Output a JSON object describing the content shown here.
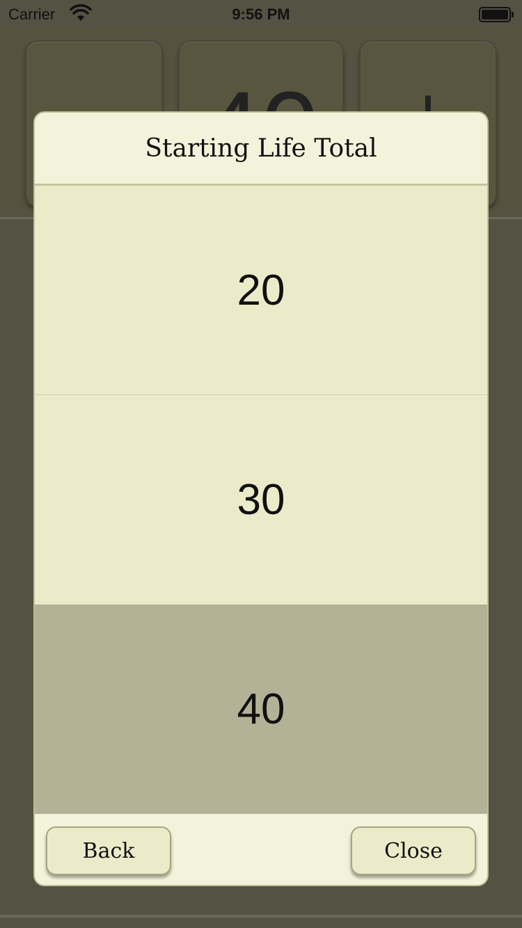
{
  "status_bar": {
    "carrier": "Carrier",
    "time": "9:56 PM",
    "wifi_icon": "wifi-icon",
    "battery_icon": "battery-icon"
  },
  "background": {
    "tile_value": "40",
    "tile_plus": "+"
  },
  "dialog": {
    "title": "Starting Life Total",
    "options": [
      {
        "label": "20",
        "selected": false
      },
      {
        "label": "30",
        "selected": false
      },
      {
        "label": "40",
        "selected": true
      }
    ],
    "back_label": "Back",
    "close_label": "Close"
  },
  "colors": {
    "background": "#545242",
    "dialog_background": "#f2f3da",
    "option_background": "#ebebca",
    "selected_option": "#b3b297"
  }
}
